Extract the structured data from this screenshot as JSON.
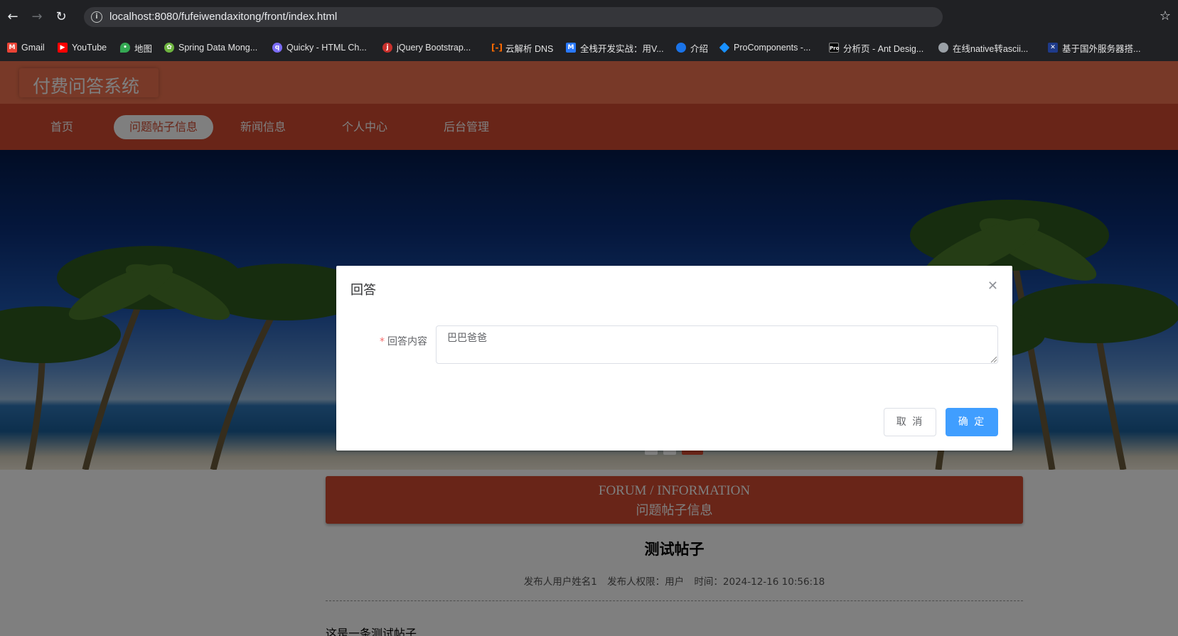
{
  "browser": {
    "url": "localhost:8080/fufeiwendaxitong/front/index.html",
    "bookmarks": [
      {
        "label": "Gmail",
        "icon": "gmail-icon",
        "color": "#ea4335"
      },
      {
        "label": "YouTube",
        "icon": "youtube-icon",
        "color": "#ff0000"
      },
      {
        "label": "地图",
        "icon": "maps-icon",
        "color": "#34a853"
      },
      {
        "label": "Spring Data Mong...",
        "icon": "spring-icon",
        "color": "#6db33f"
      },
      {
        "label": "Quicky - HTML Ch...",
        "icon": "quicky-icon",
        "color": "#7b6cf6"
      },
      {
        "label": "jQuery Bootstrap...",
        "icon": "jquery-icon",
        "color": "#c9302c"
      },
      {
        "label": "云解析 DNS",
        "icon": "aliyun-icon",
        "color": "#ff6a00"
      },
      {
        "label": "全栈开发实战：用V...",
        "icon": "m-icon",
        "color": "#2979ff"
      },
      {
        "label": "介绍",
        "icon": "globe-blue-icon",
        "color": "#1a73e8"
      },
      {
        "label": "ProComponents -...",
        "icon": "procomponents-icon",
        "color": "#1890ff"
      },
      {
        "label": "分析页 - Ant Desig...",
        "icon": "pro-icon",
        "color": "#000000"
      },
      {
        "label": "在线native转ascii...",
        "icon": "globe-icon",
        "color": "#9aa0a6"
      },
      {
        "label": "基于国外服务器搭...",
        "icon": "flag-icon",
        "color": "#1e3a8a"
      }
    ]
  },
  "site": {
    "logo": "付费问答系统",
    "nav": [
      "首页",
      "问题帖子信息",
      "新闻信息",
      "个人中心",
      "后台管理"
    ],
    "active_nav": "问题帖子信息",
    "header_color": "#f07350",
    "nav_color": "#d24b30"
  },
  "forum_header": {
    "en": "FORUM / INFORMATION",
    "cn": "问题帖子信息"
  },
  "post": {
    "title": "测试帖子",
    "author": "发布人用户姓名1",
    "role": "发布人权限：用户",
    "time": "时间：2024-12-16 10:56:18",
    "body": "这是一条测试帖子"
  },
  "dialog": {
    "title": "回答",
    "close_icon": "close-icon",
    "field_label": "回答内容",
    "field_value": "巴巴爸爸",
    "cancel_label": "取 消",
    "ok_label": "确 定",
    "primary_color": "#409eff"
  }
}
